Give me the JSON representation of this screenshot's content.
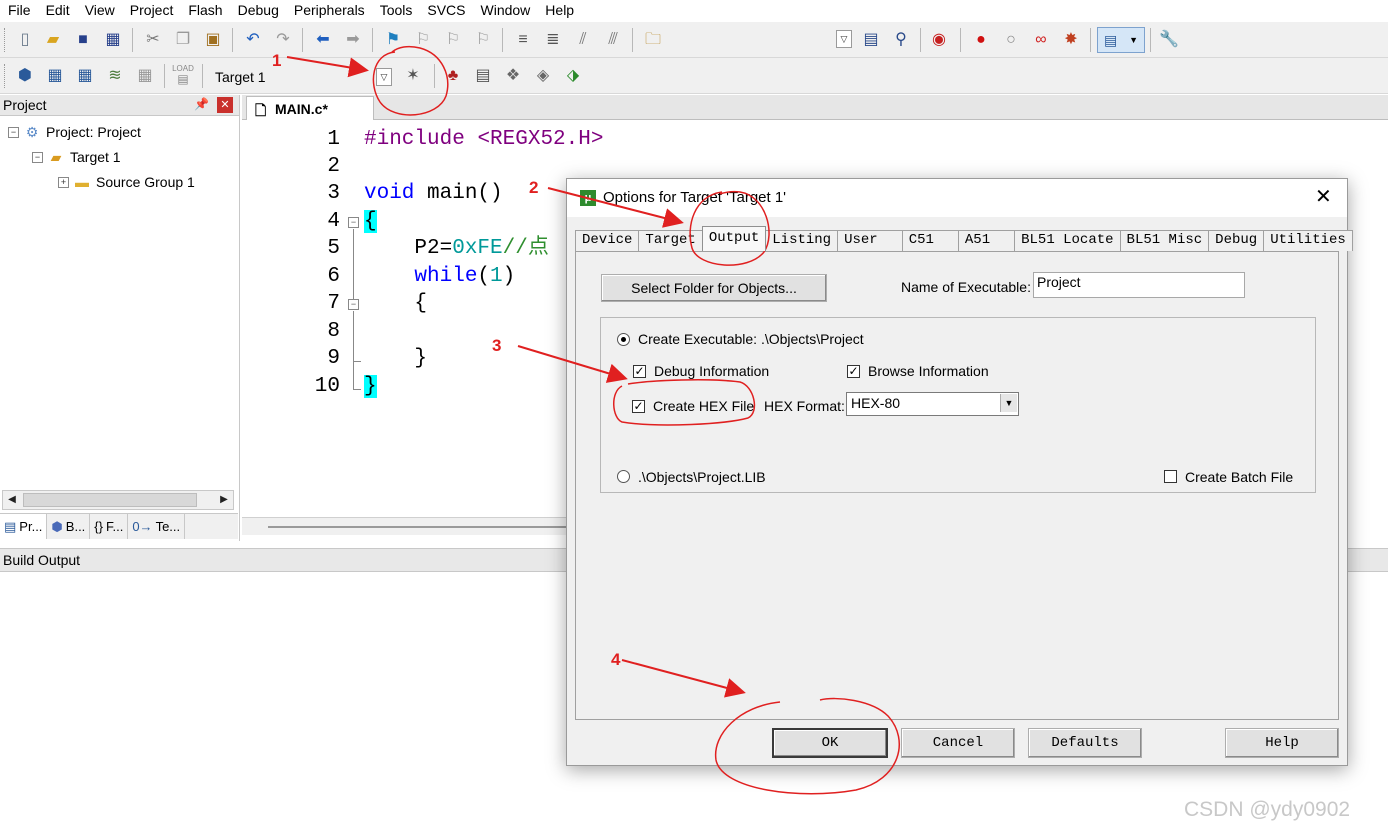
{
  "menu": [
    "File",
    "Edit",
    "View",
    "Project",
    "Flash",
    "Debug",
    "Peripherals",
    "Tools",
    "SVCS",
    "Window",
    "Help"
  ],
  "toolbar2": {
    "target": "Target 1",
    "load_label": "LOAD"
  },
  "project_panel": {
    "title": "Project",
    "close_label": "✕",
    "tree": {
      "root": "Project: Project",
      "target": "Target 1",
      "group": "Source Group 1"
    },
    "tabs": [
      "Pr...",
      "B...",
      "F...",
      "Te..."
    ]
  },
  "editor": {
    "tab": "MAIN.c*",
    "line_numbers": [
      "1",
      "2",
      "3",
      "4",
      "5",
      "6",
      "7",
      "8",
      "9",
      "10"
    ],
    "code": {
      "l1_pre": "#include",
      "l1_file": "<REGX52.H>",
      "l3_type": "void",
      "l3_rest": " main()",
      "l4_brace": "{",
      "l5_a": "    P2=",
      "l5_num": "0xFE",
      "l5_cmt": "//点",
      "l6_kw": "    while",
      "l6_open": "(",
      "l6_num": "1",
      "l6_close": ")",
      "l7": "    {",
      "l9": "    }",
      "l10_brace": "}"
    }
  },
  "build_output": {
    "title": "Build Output"
  },
  "dialog": {
    "title": "Options for Target 'Target 1'",
    "close_label": "✕",
    "tabs": [
      "Device",
      "Target",
      "Output",
      "Listing",
      "User",
      "C51",
      "A51",
      "BL51 Locate",
      "BL51 Misc",
      "Debug",
      "Utilities"
    ],
    "active_tab": "Output",
    "select_folder_label": "Select Folder for Objects...",
    "name_exec_label": "Name of Executable:",
    "name_exec_value": "Project",
    "create_exec_label": "Create Executable:  .\\Objects\\Project",
    "debug_info_label": "Debug Information",
    "browse_info_label": "Browse Information",
    "create_hex_label": "Create HEX File",
    "hex_format_label": "HEX Format:",
    "hex_format_value": "HEX-80",
    "lib_label": ".\\Objects\\Project.LIB",
    "batch_label": "Create Batch File",
    "buttons": {
      "ok": "OK",
      "cancel": "Cancel",
      "defaults": "Defaults",
      "help": "Help"
    },
    "state": {
      "create_executable": true,
      "debug_information": true,
      "browse_information": true,
      "create_hex_file": true,
      "create_batch_file": false
    }
  },
  "annotations": [
    "1",
    "2",
    "3",
    "4"
  ],
  "watermark": "CSDN @ydy0902",
  "colors": {
    "annotation": "#e02020",
    "keyword": "#0000ff",
    "preprocessor": "#7f007f",
    "number": "#009999",
    "brace_highlight": "#00ffff"
  }
}
